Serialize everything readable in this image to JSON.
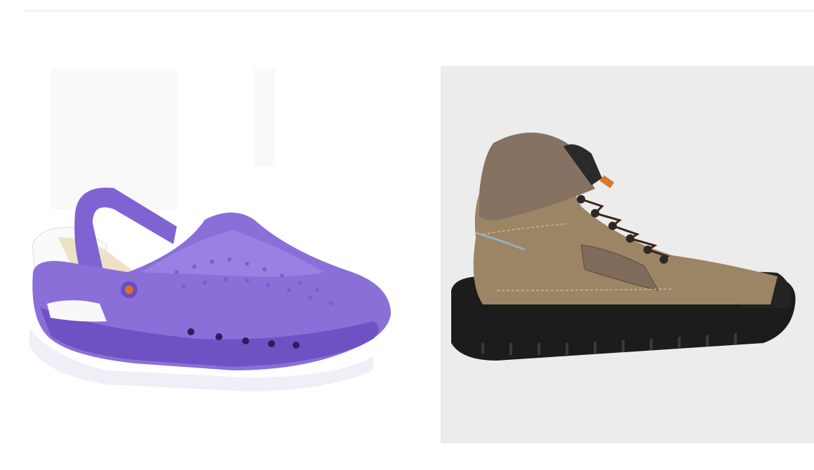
{
  "products": [
    {
      "id_label": "clog",
      "kind": "clog",
      "colors": {
        "body": "#8a6fd9",
        "dark": "#6e52c4",
        "light": "#a993ea",
        "insole": "#efe1c6",
        "sole": "#f4f4f8"
      }
    },
    {
      "id_label": "boot",
      "kind": "safety-boot",
      "colors": {
        "upper": "#9c8565",
        "mesh": "#857263",
        "sole": "#1c1c1c",
        "lace": "#2a2a2a",
        "bg": "#ececec"
      }
    }
  ]
}
